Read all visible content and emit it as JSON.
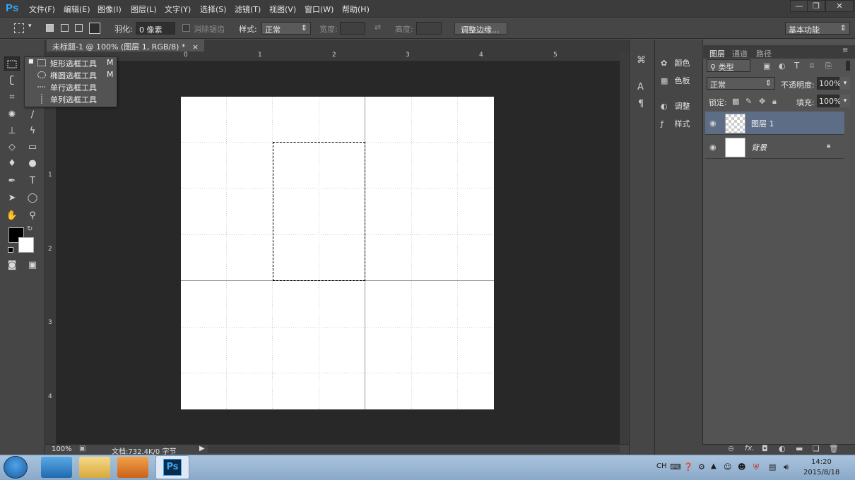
{
  "app": {
    "logo": "Ps",
    "menu": [
      "文件(F)",
      "编辑(E)",
      "图像(I)",
      "图层(L)",
      "文字(Y)",
      "选择(S)",
      "滤镜(T)",
      "视图(V)",
      "窗口(W)",
      "帮助(H)"
    ],
    "window_controls": [
      "—",
      "❐",
      "✕"
    ]
  },
  "options": {
    "feather_label": "羽化:",
    "feather_value": "0 像素",
    "antialias_label": "消除锯齿",
    "style_label": "样式:",
    "style_value": "正常",
    "width_label": "宽度:",
    "height_label": "高度:",
    "refine_edge_button": "调整边缘...",
    "workspace_value": "基本功能"
  },
  "flyout": {
    "items": [
      {
        "label": "矩形选框工具",
        "key": "M"
      },
      {
        "label": "椭圆选框工具",
        "key": "M"
      },
      {
        "label": "单行选框工具",
        "key": ""
      },
      {
        "label": "单列选框工具",
        "key": ""
      }
    ]
  },
  "document": {
    "tab_title": "未标题-1 @ 100% (图层 1, RGB/8) *",
    "ruler_top": [
      "0",
      "1",
      "2",
      "3",
      "4",
      "5"
    ],
    "ruler_left": [
      "1",
      "2",
      "3",
      "4"
    ]
  },
  "status": {
    "zoom": "100%",
    "doc_info": "文档:732.4K/0 字节"
  },
  "mini_panels": {
    "items": [
      "颜色",
      "色板",
      "调整",
      "样式"
    ]
  },
  "layers_panel": {
    "tabs": [
      "图层",
      "通道",
      "路径"
    ],
    "filter_kind": "类型",
    "blend_mode": "正常",
    "opacity_label": "不透明度:",
    "opacity_value": "100%",
    "lock_label": "锁定:",
    "fill_label": "填充:",
    "fill_value": "100%",
    "layers": [
      {
        "name": "图层 1",
        "selected": true
      },
      {
        "name": "背景",
        "selected": false
      }
    ]
  },
  "taskbar": {
    "lang": "CH",
    "time": "14:20",
    "date": "2015/8/18"
  },
  "colors": {
    "accent": "#31a8ff",
    "selected_layer": "#5d6d86",
    "canvas_bg": "#282828"
  }
}
